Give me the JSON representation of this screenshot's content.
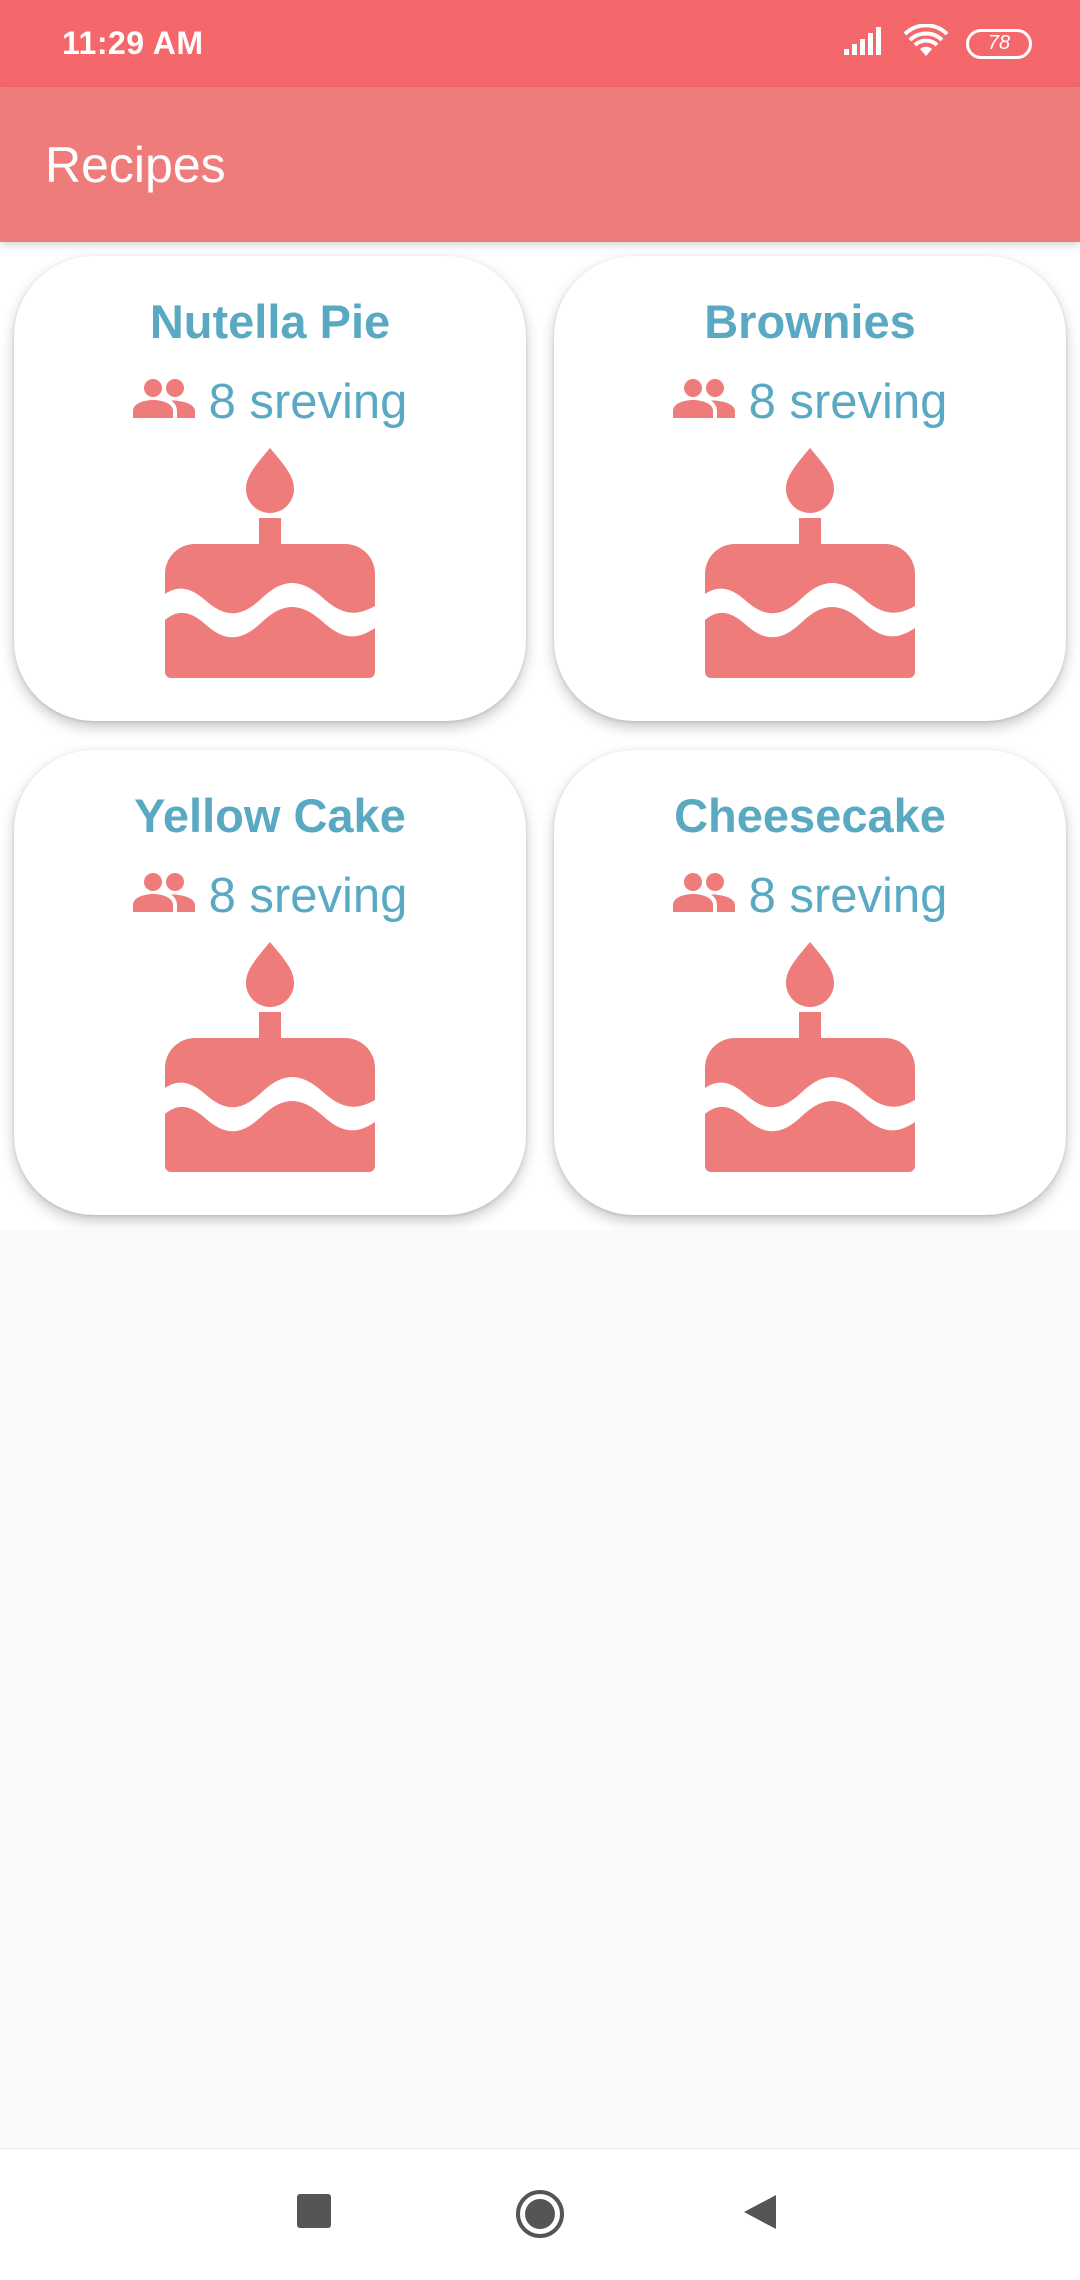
{
  "status_bar": {
    "time": "11:29 AM",
    "battery": "78",
    "icons": [
      "signal-icon",
      "wifi-icon",
      "battery-icon"
    ]
  },
  "app_bar": {
    "title": "Recipes"
  },
  "colors": {
    "status_bar": "#f4676a",
    "app_bar": "#ee7c7b",
    "accent_text": "#5aa9c3",
    "icon": "#ee7c7b"
  },
  "recipes": [
    {
      "name": "Nutella Pie",
      "serving": "8 sreving",
      "icon": "cake-icon"
    },
    {
      "name": "Brownies",
      "serving": "8 sreving",
      "icon": "cake-icon"
    },
    {
      "name": "Yellow Cake",
      "serving": "8 sreving",
      "icon": "cake-icon"
    },
    {
      "name": "Cheesecake",
      "serving": "8 sreving",
      "icon": "cake-icon"
    }
  ],
  "nav_bar": {
    "buttons": [
      "recents-button",
      "home-button",
      "back-button"
    ]
  }
}
